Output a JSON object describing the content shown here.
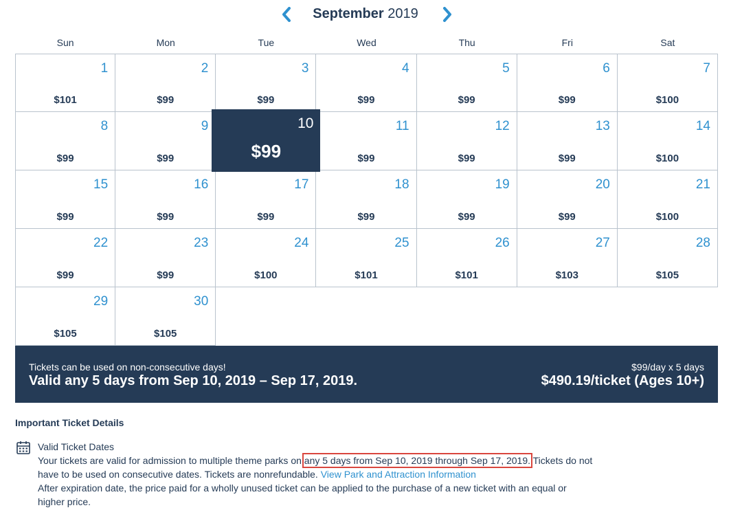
{
  "calendar": {
    "month": "September",
    "year": "2019",
    "weekdays": [
      "Sun",
      "Mon",
      "Tue",
      "Wed",
      "Thu",
      "Fri",
      "Sat"
    ],
    "days": [
      {
        "day": "1",
        "price": "$101"
      },
      {
        "day": "2",
        "price": "$99"
      },
      {
        "day": "3",
        "price": "$99"
      },
      {
        "day": "4",
        "price": "$99"
      },
      {
        "day": "5",
        "price": "$99"
      },
      {
        "day": "6",
        "price": "$99"
      },
      {
        "day": "7",
        "price": "$100"
      },
      {
        "day": "8",
        "price": "$99"
      },
      {
        "day": "9",
        "price": "$99"
      },
      {
        "day": "10",
        "price": "$99",
        "selected": true
      },
      {
        "day": "11",
        "price": "$99"
      },
      {
        "day": "12",
        "price": "$99"
      },
      {
        "day": "13",
        "price": "$99"
      },
      {
        "day": "14",
        "price": "$100"
      },
      {
        "day": "15",
        "price": "$99"
      },
      {
        "day": "16",
        "price": "$99"
      },
      {
        "day": "17",
        "price": "$99"
      },
      {
        "day": "18",
        "price": "$99"
      },
      {
        "day": "19",
        "price": "$99"
      },
      {
        "day": "20",
        "price": "$99"
      },
      {
        "day": "21",
        "price": "$100"
      },
      {
        "day": "22",
        "price": "$99"
      },
      {
        "day": "23",
        "price": "$99"
      },
      {
        "day": "24",
        "price": "$100"
      },
      {
        "day": "25",
        "price": "$101"
      },
      {
        "day": "26",
        "price": "$101"
      },
      {
        "day": "27",
        "price": "$103"
      },
      {
        "day": "28",
        "price": "$105"
      },
      {
        "day": "29",
        "price": "$105"
      },
      {
        "day": "30",
        "price": "$105"
      }
    ]
  },
  "summary": {
    "note": "Tickets can be used on non-consecutive days!",
    "valid_range": "Valid any 5 days from Sep 10, 2019 – Sep 17, 2019.",
    "per_day": "$99/day x 5 days",
    "total": "$490.19/ticket (Ages 10+)"
  },
  "details": {
    "title": "Important Ticket Details",
    "section_title": "Valid Ticket Dates",
    "text_before": "Your tickets are valid for admission to multiple theme parks on ",
    "highlight": "any 5 days from Sep 10, 2019 through Sep 17, 2019.",
    "text_after": " Tickets do not have to be used on consecutive dates. Tickets are nonrefundable. ",
    "link": "View Park and Attraction Information",
    "text_end": "After expiration date, the price paid for a wholly unused ticket can be applied to the purchase of a new ticket with an equal or higher price."
  },
  "colors": {
    "navy": "#253b56",
    "accent_blue": "#2f91cf",
    "highlight_border": "#d9463e"
  },
  "icons": [
    "chevron-left-icon",
    "chevron-right-icon",
    "calendar-icon"
  ]
}
